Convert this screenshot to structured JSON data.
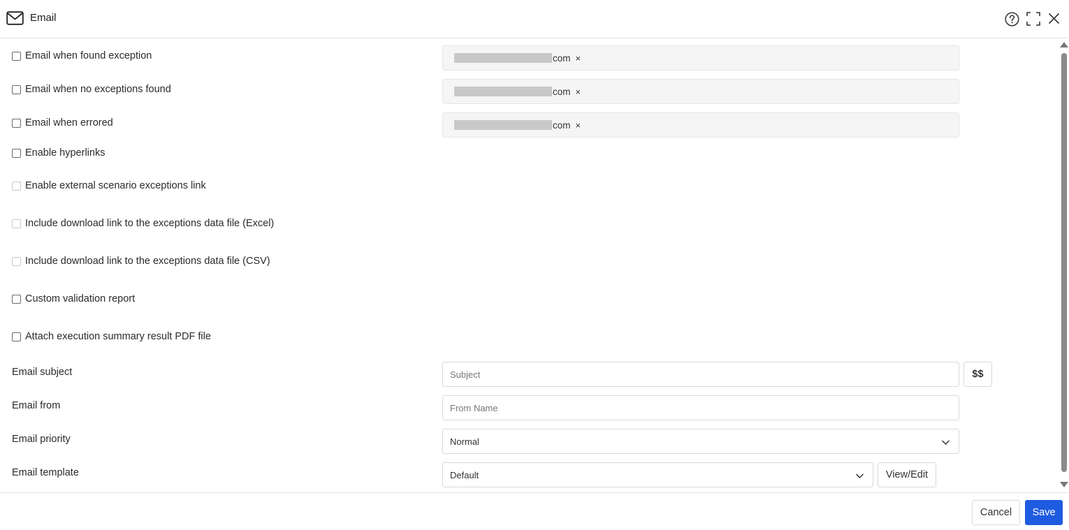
{
  "header": {
    "title": "Email",
    "icons": {
      "left": "envelope-icon",
      "help": "help-circle-icon",
      "expand": "expand-icon",
      "close": "close-icon"
    }
  },
  "checkbox_rows": [
    {
      "label": "Email when found exception",
      "checked": false,
      "disabled": false
    },
    {
      "label": "Email when no exceptions found",
      "checked": false,
      "disabled": false
    },
    {
      "label": "Email when errored",
      "checked": false,
      "disabled": false
    },
    {
      "label": "Enable hyperlinks",
      "checked": false,
      "disabled": false
    },
    {
      "label": "Enable external scenario exceptions link",
      "checked": false,
      "disabled": true
    },
    {
      "label": "Include download link to the exceptions data file (Excel)",
      "checked": false,
      "disabled": true
    },
    {
      "label": "Include download link to the exceptions data file (CSV)",
      "checked": false,
      "disabled": true
    },
    {
      "label": "Custom validation report",
      "checked": false,
      "disabled": false
    },
    {
      "label": "Attach execution summary result PDF file",
      "checked": false,
      "disabled": false
    }
  ],
  "recipients": [
    {
      "suffix": "com",
      "remove": "×"
    },
    {
      "suffix": "com",
      "remove": "×"
    },
    {
      "suffix": "com",
      "remove": "×"
    }
  ],
  "fields": {
    "subject": {
      "label": "Email subject",
      "placeholder": "Subject",
      "var_button": "$$"
    },
    "from": {
      "label": "Email from",
      "placeholder": "From Name"
    },
    "priority": {
      "label": "Email priority",
      "value": "Normal"
    },
    "template": {
      "label": "Email template",
      "value": "Default",
      "edit_button": "View/Edit"
    }
  },
  "footer": {
    "cancel_label": "Cancel",
    "save_label": "Save"
  },
  "colors": {
    "primary": "#1f5be0",
    "icon": "#333333"
  }
}
